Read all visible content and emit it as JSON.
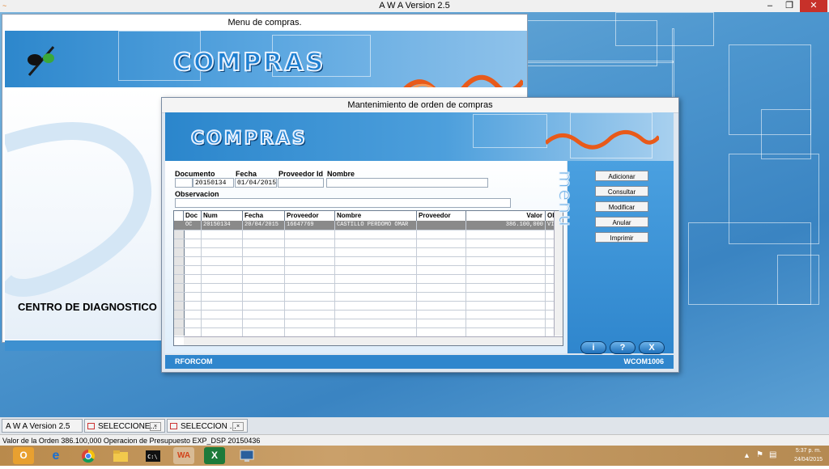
{
  "app": {
    "title": "A W A Version 2.5"
  },
  "menu_window": {
    "title": "Menu de compras.",
    "banner_word": "COMPRAS",
    "centro_label": "CENTRO DE DIAGNOSTICO"
  },
  "mant_window": {
    "title": "Mantenimiento de orden de compras",
    "banner_word": "COMPRAS",
    "form": {
      "documento_label": "Documento",
      "documento_prefix": "",
      "documento_value": "20150134",
      "fecha_label": "Fecha",
      "fecha_value": "01/04/2015",
      "proveedor_label": "Proveedor Id",
      "proveedor_value": "",
      "nombre_label": "Nombre",
      "nombre_value": "",
      "observacion_label": "Observacion",
      "observacion_value": ""
    },
    "grid": {
      "columns": [
        "Doc",
        "Num",
        "Fecha",
        "Proveedor Req.",
        "Nombre",
        "Proveedor Coti.",
        "Valor",
        "Ob"
      ],
      "rows": [
        [
          "OC",
          "20150134",
          "20/04/2015",
          "16647769",
          "CASTILLO PERDOMO OMAR",
          "",
          "386.100,000",
          "VIA"
        ]
      ]
    },
    "side_buttons": [
      "Adicionar",
      "Consultar",
      "Modificar",
      "Anular",
      "Imprimir"
    ],
    "side_vertical_label": "menu",
    "round_buttons": [
      "i",
      "?",
      "X"
    ],
    "status_left": "RFORCOM",
    "status_right": "WCOM1006"
  },
  "task_tabs": [
    {
      "label": "A W A Version 2.5"
    },
    {
      "label": "SELECCIONE..."
    },
    {
      "label": "SELECCION ..."
    }
  ],
  "statusbar": {
    "text": "Valor de la Orden  386.100,000 Operacion de Presupuesto EXP_DSP  20150436"
  },
  "clock": {
    "time": "5:37 p. m.",
    "date": "24/04/2015"
  },
  "colors": {
    "banner_blue": "#2d87cc",
    "selected_row": "#8a8a8a",
    "desktop_blue": "#4e97cf"
  }
}
